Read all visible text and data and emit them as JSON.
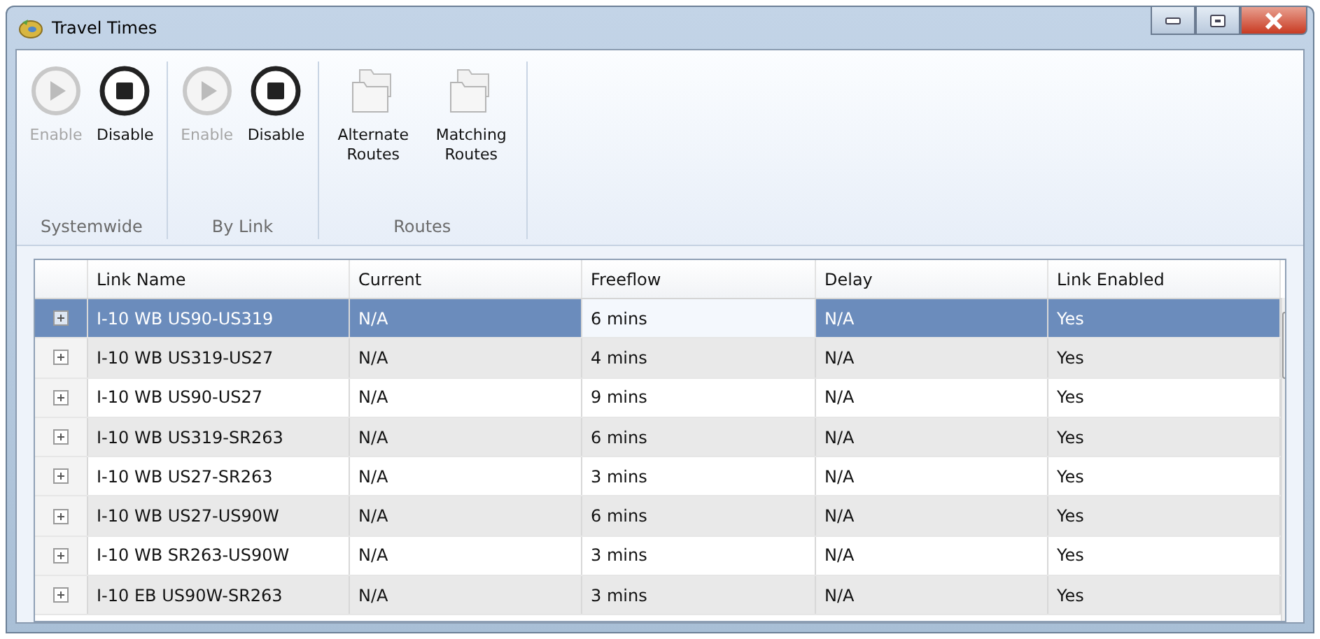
{
  "window": {
    "title": "Travel Times"
  },
  "ribbon": {
    "groups": [
      {
        "label": "Systemwide",
        "buttons": [
          {
            "kind": "play",
            "label": "Enable",
            "disabled": true
          },
          {
            "kind": "stop",
            "label": "Disable",
            "disabled": false
          }
        ]
      },
      {
        "label": "By Link",
        "buttons": [
          {
            "kind": "play",
            "label": "Enable",
            "disabled": true
          },
          {
            "kind": "stop",
            "label": "Disable",
            "disabled": false
          }
        ]
      },
      {
        "label": "Routes",
        "buttons": [
          {
            "kind": "folder",
            "label": "Alternate Routes",
            "disabled": false
          },
          {
            "kind": "folder",
            "label": "Matching Routes",
            "disabled": false
          }
        ]
      }
    ]
  },
  "table": {
    "columns": [
      {
        "label": "Link Name",
        "focused": false
      },
      {
        "label": "Current",
        "focused": false
      },
      {
        "label": "Freeflow",
        "focused": true
      },
      {
        "label": "Delay",
        "focused": false
      },
      {
        "label": "Link Enabled",
        "focused": false
      }
    ],
    "rows": [
      {
        "selected": true,
        "cells": [
          "I-10 WB US90-US319",
          "N/A",
          "6 mins",
          "N/A",
          "Yes"
        ]
      },
      {
        "selected": false,
        "cells": [
          "I-10 WB US319-US27",
          "N/A",
          "4 mins",
          "N/A",
          "Yes"
        ]
      },
      {
        "selected": false,
        "cells": [
          "I-10 WB US90-US27",
          "N/A",
          "9 mins",
          "N/A",
          "Yes"
        ]
      },
      {
        "selected": false,
        "cells": [
          "I-10 WB US319-SR263",
          "N/A",
          "6 mins",
          "N/A",
          "Yes"
        ]
      },
      {
        "selected": false,
        "cells": [
          "I-10 WB US27-SR263",
          "N/A",
          "3 mins",
          "N/A",
          "Yes"
        ]
      },
      {
        "selected": false,
        "cells": [
          "I-10 WB US27-US90W",
          "N/A",
          "6 mins",
          "N/A",
          "Yes"
        ]
      },
      {
        "selected": false,
        "cells": [
          "I-10 WB SR263-US90W",
          "N/A",
          "3 mins",
          "N/A",
          "Yes"
        ]
      },
      {
        "selected": false,
        "cells": [
          "I-10 EB US90W-SR263",
          "N/A",
          "3 mins",
          "N/A",
          "Yes"
        ]
      }
    ]
  }
}
